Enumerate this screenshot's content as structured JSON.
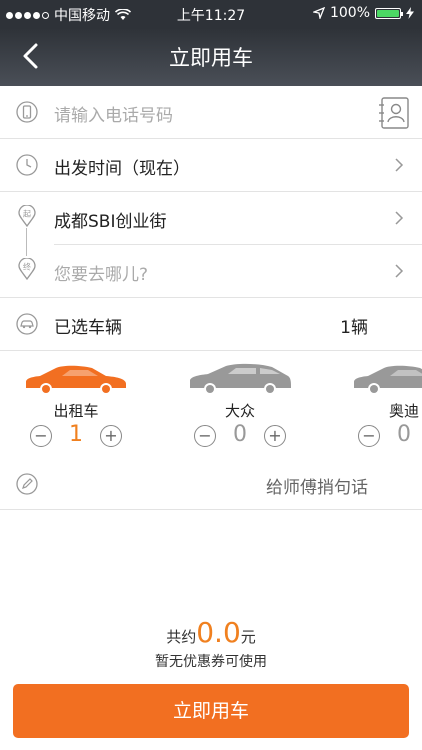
{
  "status_bar": {
    "carrier": "中国移动",
    "time": "上午11:27",
    "battery": "100%"
  },
  "nav": {
    "title": "立即用车"
  },
  "phone": {
    "placeholder": "请输入电话号码"
  },
  "depart_time": {
    "label": "出发时间（现在）"
  },
  "route": {
    "from": "成都SBI创业街",
    "from_marker": "起",
    "to_placeholder": "您要去哪儿?",
    "to_marker": "终"
  },
  "vehicles": {
    "label": "已选车辆",
    "count": "1辆"
  },
  "cars": [
    {
      "name": "出租车",
      "count": "1",
      "color": "#f26f21"
    },
    {
      "name": "大众",
      "count": "0",
      "color": "#999999"
    },
    {
      "name": "奥迪",
      "count": "0",
      "color": "#999999"
    }
  ],
  "remark": {
    "placeholder": "给师傅捎句话"
  },
  "summary": {
    "prefix": "共约",
    "amount": "0.0",
    "unit": "元",
    "coupon": "暂无优惠券可使用"
  },
  "button": {
    "label": "立即用车"
  },
  "colors": {
    "accent": "#f26f21",
    "nav_bg": "#2e3238"
  }
}
